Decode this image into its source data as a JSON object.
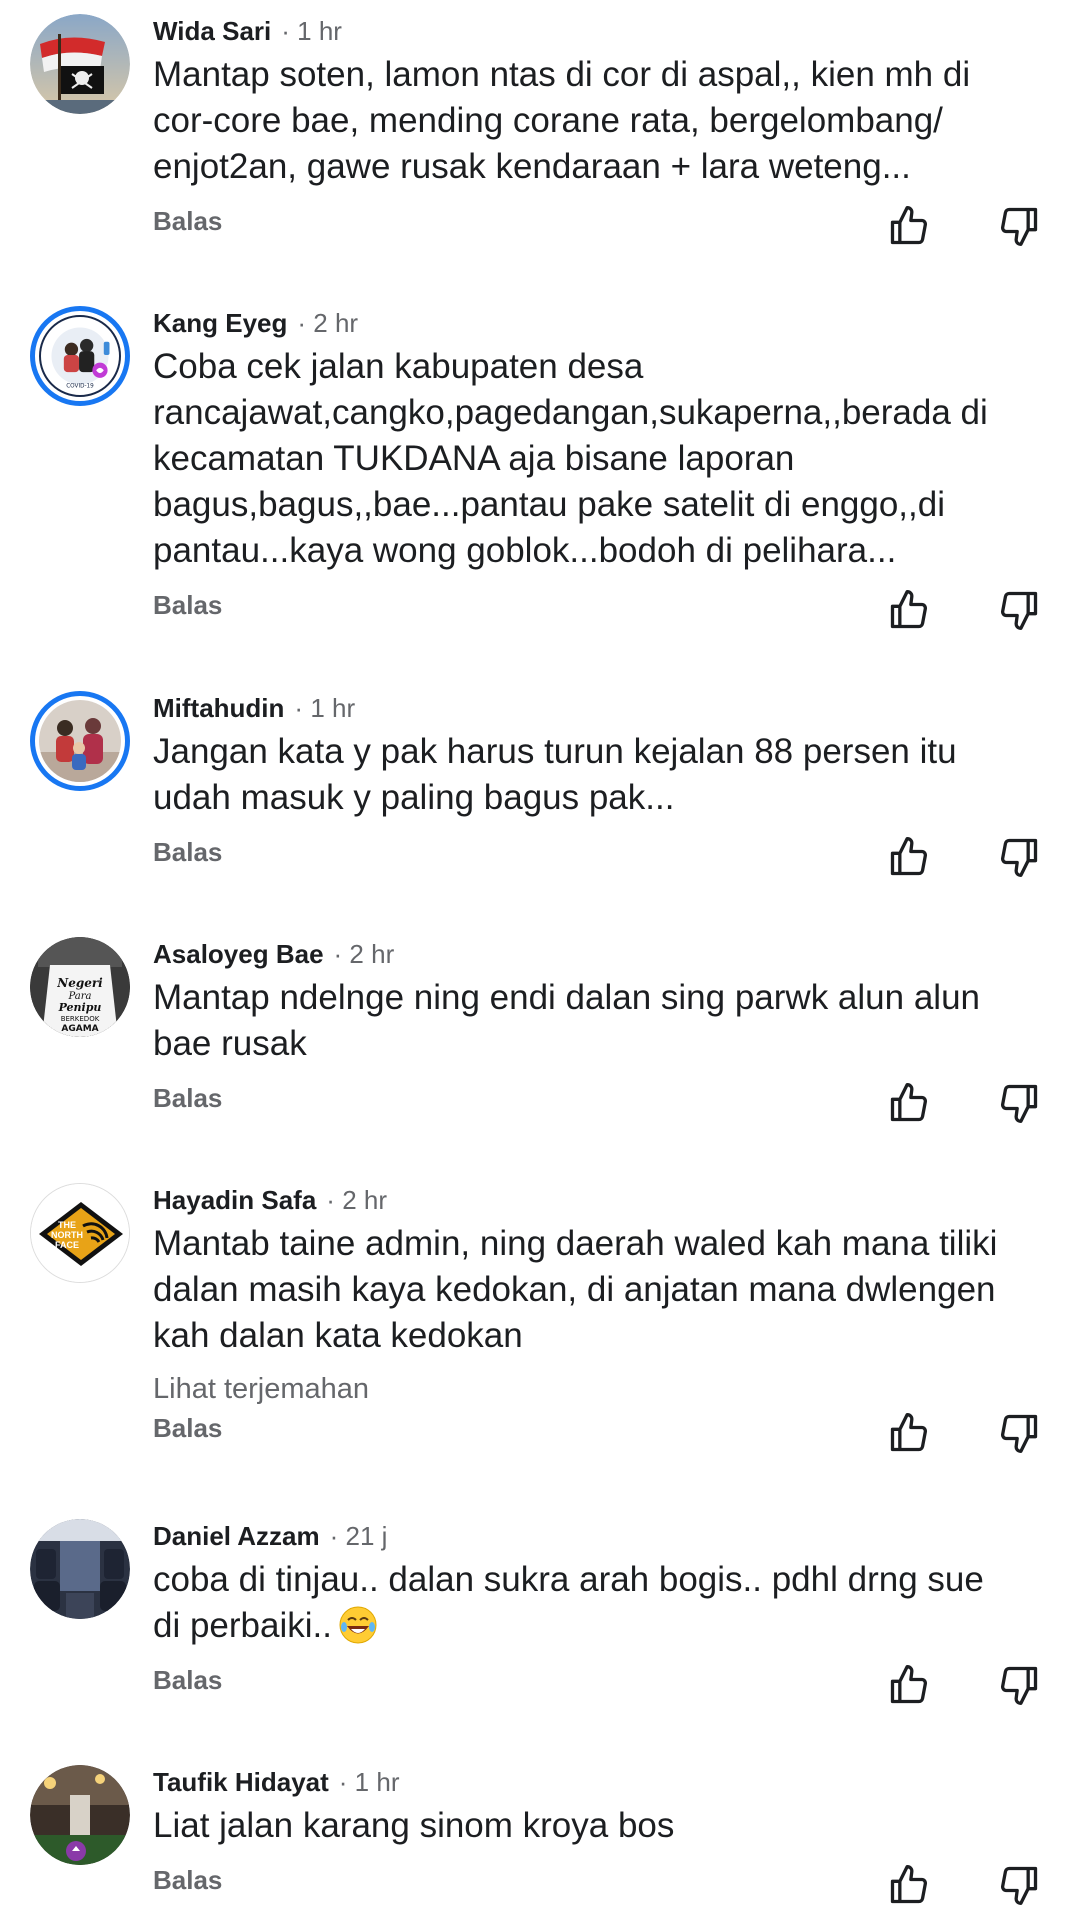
{
  "reply_label": "Balas",
  "translate_label": "Lihat terjemahan",
  "comments": [
    {
      "author": "Wida Sari",
      "time": "1 hr",
      "text": "Mantap soten, lamon ntas di cor di aspal,, kien mh di\ncor-core bae, mending corane rata, bergelombang/\nenjot2an, gawe rusak kendaraan + lara weteng..."
    },
    {
      "author": "Kang Eyeg",
      "time": "2 hr",
      "text": "Coba cek jalan kabupaten desa\nrancajawat,cangko,pagedangan,sukaperna,,berada di\nkecamatan TUKDANA aja bisane laporan\nbagus,bagus,,bae...pantau pake satelit di enggo,,di\npantau...kaya wong goblok...bodoh di pelihara..."
    },
    {
      "author": "Miftahudin",
      "time": "1 hr",
      "text": "Jangan kata y pak harus turun kejalan 88 persen itu\nudah masuk y paling bagus pak..."
    },
    {
      "author": "Asaloyeg Bae",
      "time": "2 hr",
      "text": "Mantap ndelnge ning endi dalan sing parwk alun alun\nbae rusak"
    },
    {
      "author": "Hayadin Safa",
      "time": "2 hr",
      "text": "Mantab taine admin, ning daerah waled kah mana tiliki\ndalan masih kaya kedokan, di anjatan mana dwlengen\nkah dalan kata kedokan"
    },
    {
      "author": "Daniel Azzam",
      "time": "21 j",
      "text": "coba di tinjau.. dalan sukra arah bogis.. pdhl drng sue\ndi perbaiki.."
    },
    {
      "author": "Taufik Hidayat",
      "time": "1 hr",
      "text": "Liat jalan karang sinom kroya bos"
    }
  ],
  "avatar_text": {
    "asaloyeg": [
      "Negeri",
      "Para",
      "Penipu",
      "BERKEDOK",
      "AGAMA"
    ],
    "hayadin": [
      "THE",
      "NORTH",
      "FACE"
    ],
    "kang_eyeg": "COVID-19"
  },
  "colors": {
    "ring": "#1877f2",
    "secondary_text": "#65676b",
    "primary_text": "#1c1e21"
  },
  "icons": {
    "like": "thumbs-up-icon",
    "dislike": "thumbs-down-icon",
    "emoji": "laughing-tears-emoji"
  }
}
